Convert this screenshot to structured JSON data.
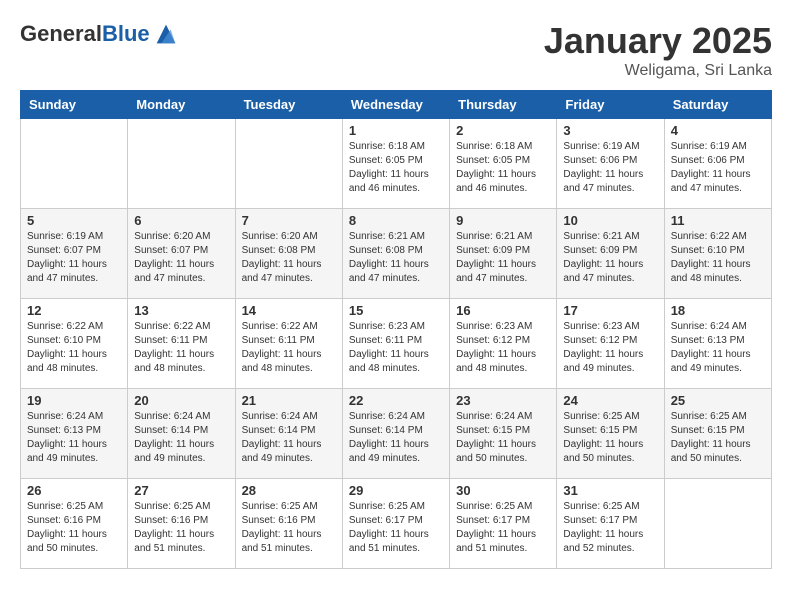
{
  "header": {
    "logo_general": "General",
    "logo_blue": "Blue",
    "month_title": "January 2025",
    "location": "Weligama, Sri Lanka"
  },
  "days_of_week": [
    "Sunday",
    "Monday",
    "Tuesday",
    "Wednesday",
    "Thursday",
    "Friday",
    "Saturday"
  ],
  "weeks": [
    [
      {
        "day": "",
        "info": ""
      },
      {
        "day": "",
        "info": ""
      },
      {
        "day": "",
        "info": ""
      },
      {
        "day": "1",
        "info": "Sunrise: 6:18 AM\nSunset: 6:05 PM\nDaylight: 11 hours\nand 46 minutes."
      },
      {
        "day": "2",
        "info": "Sunrise: 6:18 AM\nSunset: 6:05 PM\nDaylight: 11 hours\nand 46 minutes."
      },
      {
        "day": "3",
        "info": "Sunrise: 6:19 AM\nSunset: 6:06 PM\nDaylight: 11 hours\nand 47 minutes."
      },
      {
        "day": "4",
        "info": "Sunrise: 6:19 AM\nSunset: 6:06 PM\nDaylight: 11 hours\nand 47 minutes."
      }
    ],
    [
      {
        "day": "5",
        "info": "Sunrise: 6:19 AM\nSunset: 6:07 PM\nDaylight: 11 hours\nand 47 minutes."
      },
      {
        "day": "6",
        "info": "Sunrise: 6:20 AM\nSunset: 6:07 PM\nDaylight: 11 hours\nand 47 minutes."
      },
      {
        "day": "7",
        "info": "Sunrise: 6:20 AM\nSunset: 6:08 PM\nDaylight: 11 hours\nand 47 minutes."
      },
      {
        "day": "8",
        "info": "Sunrise: 6:21 AM\nSunset: 6:08 PM\nDaylight: 11 hours\nand 47 minutes."
      },
      {
        "day": "9",
        "info": "Sunrise: 6:21 AM\nSunset: 6:09 PM\nDaylight: 11 hours\nand 47 minutes."
      },
      {
        "day": "10",
        "info": "Sunrise: 6:21 AM\nSunset: 6:09 PM\nDaylight: 11 hours\nand 47 minutes."
      },
      {
        "day": "11",
        "info": "Sunrise: 6:22 AM\nSunset: 6:10 PM\nDaylight: 11 hours\nand 48 minutes."
      }
    ],
    [
      {
        "day": "12",
        "info": "Sunrise: 6:22 AM\nSunset: 6:10 PM\nDaylight: 11 hours\nand 48 minutes."
      },
      {
        "day": "13",
        "info": "Sunrise: 6:22 AM\nSunset: 6:11 PM\nDaylight: 11 hours\nand 48 minutes."
      },
      {
        "day": "14",
        "info": "Sunrise: 6:22 AM\nSunset: 6:11 PM\nDaylight: 11 hours\nand 48 minutes."
      },
      {
        "day": "15",
        "info": "Sunrise: 6:23 AM\nSunset: 6:11 PM\nDaylight: 11 hours\nand 48 minutes."
      },
      {
        "day": "16",
        "info": "Sunrise: 6:23 AM\nSunset: 6:12 PM\nDaylight: 11 hours\nand 48 minutes."
      },
      {
        "day": "17",
        "info": "Sunrise: 6:23 AM\nSunset: 6:12 PM\nDaylight: 11 hours\nand 49 minutes."
      },
      {
        "day": "18",
        "info": "Sunrise: 6:24 AM\nSunset: 6:13 PM\nDaylight: 11 hours\nand 49 minutes."
      }
    ],
    [
      {
        "day": "19",
        "info": "Sunrise: 6:24 AM\nSunset: 6:13 PM\nDaylight: 11 hours\nand 49 minutes."
      },
      {
        "day": "20",
        "info": "Sunrise: 6:24 AM\nSunset: 6:14 PM\nDaylight: 11 hours\nand 49 minutes."
      },
      {
        "day": "21",
        "info": "Sunrise: 6:24 AM\nSunset: 6:14 PM\nDaylight: 11 hours\nand 49 minutes."
      },
      {
        "day": "22",
        "info": "Sunrise: 6:24 AM\nSunset: 6:14 PM\nDaylight: 11 hours\nand 49 minutes."
      },
      {
        "day": "23",
        "info": "Sunrise: 6:24 AM\nSunset: 6:15 PM\nDaylight: 11 hours\nand 50 minutes."
      },
      {
        "day": "24",
        "info": "Sunrise: 6:25 AM\nSunset: 6:15 PM\nDaylight: 11 hours\nand 50 minutes."
      },
      {
        "day": "25",
        "info": "Sunrise: 6:25 AM\nSunset: 6:15 PM\nDaylight: 11 hours\nand 50 minutes."
      }
    ],
    [
      {
        "day": "26",
        "info": "Sunrise: 6:25 AM\nSunset: 6:16 PM\nDaylight: 11 hours\nand 50 minutes."
      },
      {
        "day": "27",
        "info": "Sunrise: 6:25 AM\nSunset: 6:16 PM\nDaylight: 11 hours\nand 51 minutes."
      },
      {
        "day": "28",
        "info": "Sunrise: 6:25 AM\nSunset: 6:16 PM\nDaylight: 11 hours\nand 51 minutes."
      },
      {
        "day": "29",
        "info": "Sunrise: 6:25 AM\nSunset: 6:17 PM\nDaylight: 11 hours\nand 51 minutes."
      },
      {
        "day": "30",
        "info": "Sunrise: 6:25 AM\nSunset: 6:17 PM\nDaylight: 11 hours\nand 51 minutes."
      },
      {
        "day": "31",
        "info": "Sunrise: 6:25 AM\nSunset: 6:17 PM\nDaylight: 11 hours\nand 52 minutes."
      },
      {
        "day": "",
        "info": ""
      }
    ]
  ]
}
